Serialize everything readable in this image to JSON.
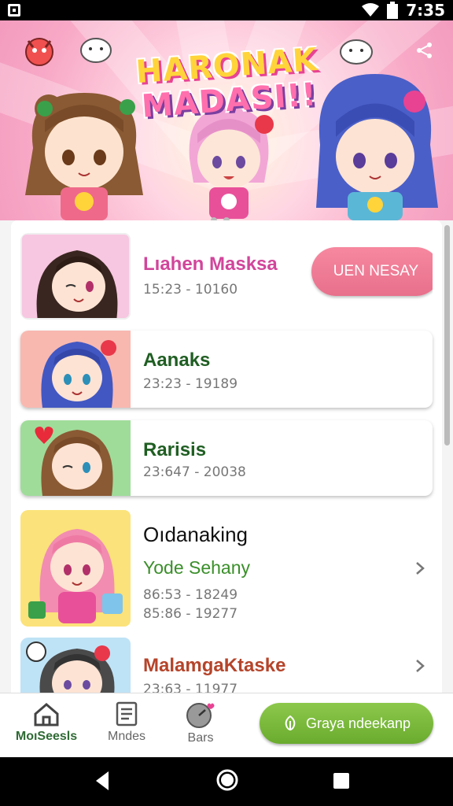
{
  "status_bar": {
    "time": "7:35"
  },
  "banner": {
    "title_line1": "HARONAK",
    "title_line2": "MADASI!!"
  },
  "list": {
    "items": [
      {
        "name": "Lıahen Masksa",
        "meta": "15:23 - 10160",
        "action_label": "UEN NESAY",
        "name_color": "#d1459b",
        "thumb_bg": "#f7c6e0"
      },
      {
        "name": "Aanaks",
        "meta": "23:23 - 19189",
        "name_color": "#1f5e22",
        "thumb_bg": "#f8b8b0"
      },
      {
        "name": "Rarisis",
        "meta": "23:647 - 20038",
        "name_color": "#1f5e22",
        "thumb_bg": "#9fdc9a"
      },
      {
        "name": "Oıdanaking",
        "subtitle": "Yode Sehany",
        "meta1": "86:53 - 18249",
        "meta2": "85:86 - 19277",
        "name_color": "#111111",
        "subtitle_color": "#3a8f2a",
        "thumb_bg": "#fbe27a"
      },
      {
        "name": "MalamgaKtaske",
        "meta": "23:63 - 11977",
        "name_color": "#b5442a",
        "thumb_bg": "#bfe3f6"
      }
    ]
  },
  "bottom_nav": {
    "items": [
      {
        "label": "MoıSeesls",
        "icon": "house-icon",
        "active": true
      },
      {
        "label": "Mndes",
        "icon": "document-icon",
        "active": false
      },
      {
        "label": "Bars",
        "icon": "gauge-icon",
        "active": false
      }
    ],
    "cta_label": "Graya ndeekanp"
  }
}
